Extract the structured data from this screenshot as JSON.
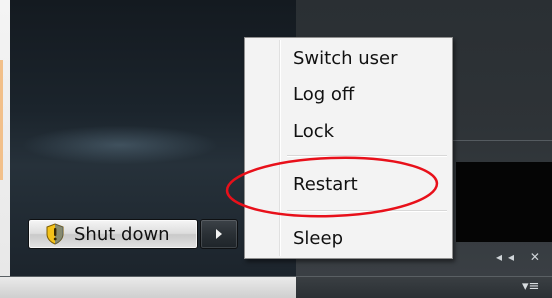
{
  "start_menu": {
    "shutdown_button": {
      "label": "Shut down",
      "icon": "uac-shield-icon"
    },
    "options_arrow": {
      "icon": "right-arrow-icon"
    }
  },
  "power_menu": {
    "items": [
      {
        "label": "Switch user"
      },
      {
        "label": "Log off"
      },
      {
        "label": "Lock"
      },
      {
        "label": "Restart"
      },
      {
        "label": "Sleep"
      }
    ]
  },
  "media_controls": {
    "label": "◂◂ ✕"
  },
  "annotation": {
    "color": "#e8101a",
    "target": "Restart"
  },
  "colors": {
    "shield_yellow": "#f3c21a",
    "shield_blue": "#2e5fb8"
  }
}
